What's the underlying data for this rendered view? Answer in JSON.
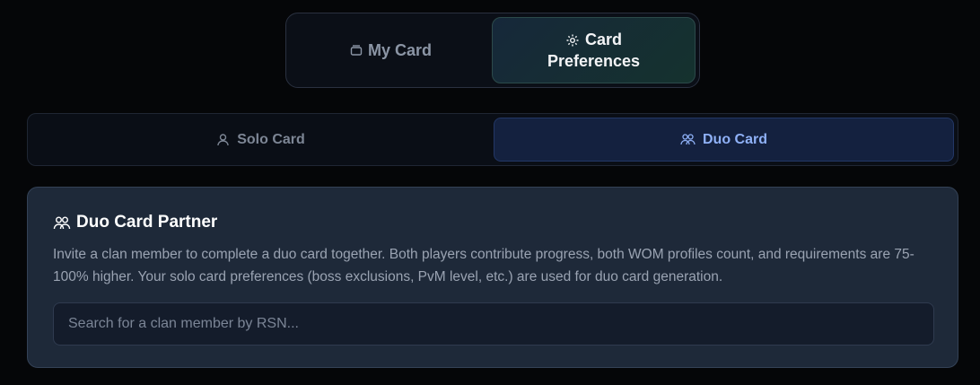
{
  "top_tabs": {
    "my_card": {
      "label": "My Card",
      "icon": "card-icon"
    },
    "card_preferences": {
      "label_line1": "Card",
      "label_line2": "Preferences",
      "icon": "gear-icon",
      "active": true
    }
  },
  "sub_tabs": {
    "solo": {
      "label": "Solo Card",
      "icon": "user-icon"
    },
    "duo": {
      "label": "Duo Card",
      "icon": "users-icon",
      "active": true
    }
  },
  "duo_panel": {
    "title": "Duo Card Partner",
    "icon": "users-icon",
    "description": "Invite a clan member to complete a duo card together. Both players contribute progress, both WOM profiles count, and requirements are 75-100% higher. Your solo card preferences (boss exclusions, PvM level, etc.) are used for duo card generation.",
    "search": {
      "placeholder": "Search for a clan member by RSN...",
      "value": ""
    }
  },
  "colors": {
    "background": "#050608",
    "active_sub_tab_text": "#8fb1f7",
    "panel_bg": "#1e2939"
  }
}
